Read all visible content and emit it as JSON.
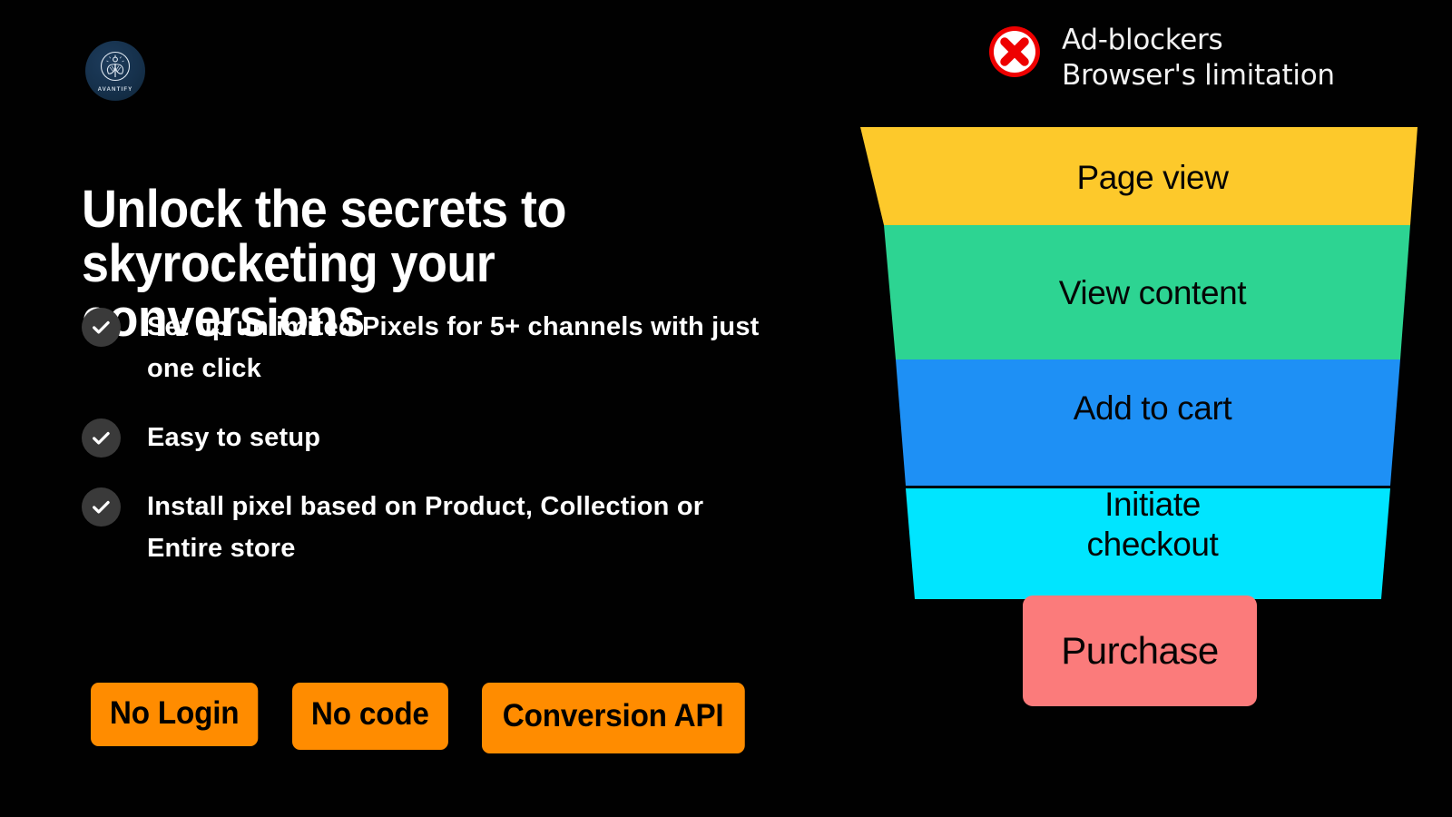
{
  "brand": {
    "logo_icon": "avantify-leaf-logo-icon",
    "name": "AVANTIFY"
  },
  "headline": "Unlock the secrets to skyrocketing your conversions",
  "features": [
    {
      "icon": "check-circle-icon",
      "text": "Set up unlimited Pixels for 5+ channels with just one click"
    },
    {
      "icon": "check-circle-icon",
      "text": "Easy to setup"
    },
    {
      "icon": "check-circle-icon",
      "text": "Install pixel based on Product, Collection or Entire store"
    }
  ],
  "pills": [
    {
      "label": "No Login"
    },
    {
      "label": "No code"
    },
    {
      "label": "Conversion API"
    }
  ],
  "warning": {
    "icon": "error-x-circle-icon",
    "line1": "Ad-blockers",
    "line2": "Browser's limitation"
  },
  "funnel": {
    "stages": [
      {
        "label": "Page view",
        "color": "#FDC92B"
      },
      {
        "label": "View content",
        "color": "#2DD492"
      },
      {
        "label": "Add to cart",
        "color": "#1E90F5"
      },
      {
        "label": "Initiate\ncheckout",
        "color": "#00E5FF"
      },
      {
        "label": "Purchase",
        "color": "#FB7B7B"
      }
    ]
  },
  "colors": {
    "background": "#010101",
    "accent_orange": "#FF8C00",
    "text_primary": "#FFFFFF",
    "check_badge": "#3A3A3A",
    "warning_red": "#EE0000",
    "logo_navy": "#16314C"
  }
}
